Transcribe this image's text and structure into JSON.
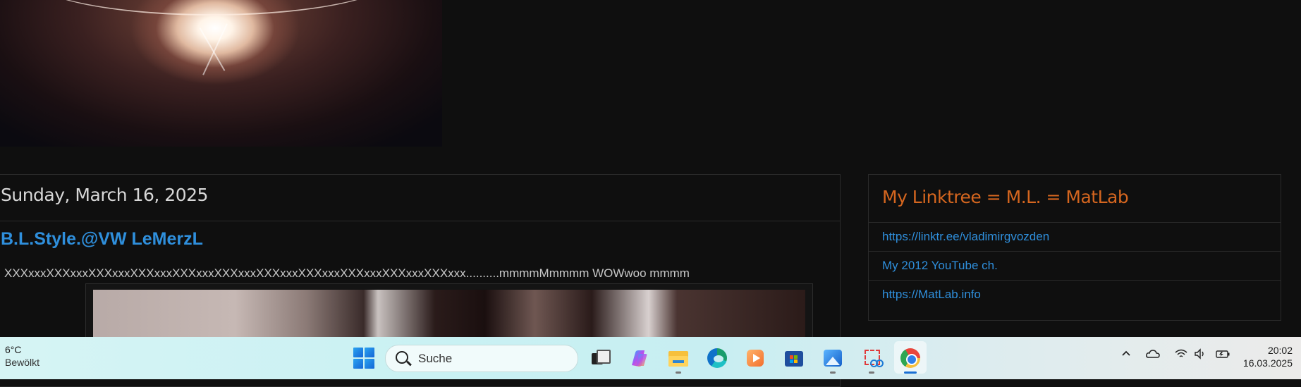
{
  "blog": {
    "date_header": "Sunday, March 16, 2025",
    "post_title": "B.L.Style.@VW LeMerzL",
    "post_text": "XXXxxxXXXxxxXXXxxxXXXxxxXXXxxxXXXxxxXXXxxxXXXxxxXXXxxxXXXxxxXXXxxx..........mmmmMmmmm WOWwoo mmmm"
  },
  "sidebar": {
    "title": "My Linktree = M.L. = MatLab",
    "links": [
      {
        "label": "https://linktr.ee/vladimirgvozden"
      },
      {
        "label": "My 2012 YouTube ch."
      },
      {
        "label": "https://MatLab.info"
      }
    ]
  },
  "taskbar": {
    "weather": {
      "temp": "6°C",
      "condition": "Bewölkt"
    },
    "search": {
      "placeholder": "Suche"
    },
    "apps": [
      {
        "name": "task-view-icon"
      },
      {
        "name": "copilot-icon"
      },
      {
        "name": "file-explorer-icon"
      },
      {
        "name": "edge-icon"
      },
      {
        "name": "media-player-icon"
      },
      {
        "name": "store-icon"
      },
      {
        "name": "photos-icon"
      },
      {
        "name": "snipping-tool-icon"
      },
      {
        "name": "chrome-icon"
      }
    ],
    "clock": {
      "time": "20:02",
      "date": "16.03.2025"
    }
  },
  "colors": {
    "link": "#2f8fdc",
    "sidebar_title": "#d5661f",
    "background": "#0f0f0f"
  }
}
